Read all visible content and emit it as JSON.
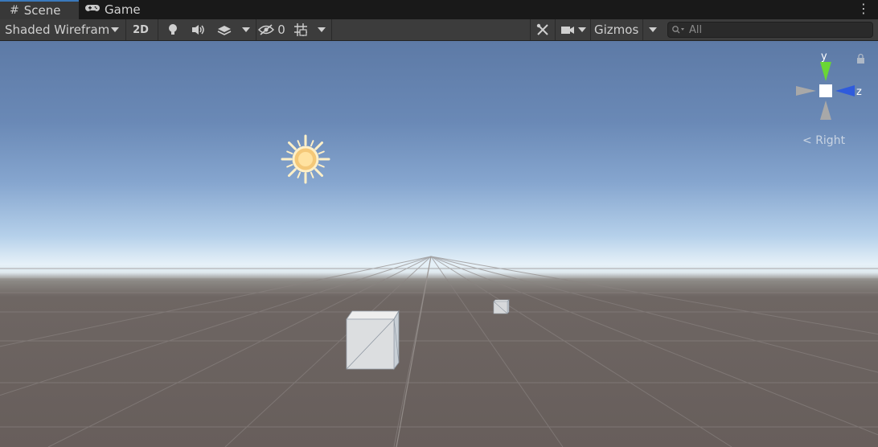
{
  "tabs": [
    {
      "label": "Scene",
      "icon": "grid-icon",
      "active": true
    },
    {
      "label": "Game",
      "icon": "gamepad-icon",
      "active": false
    }
  ],
  "toolbar": {
    "draw_mode": "Shaded Wireframe",
    "mode_2d": "2D",
    "hidden_count": "0",
    "gizmos": "Gizmos"
  },
  "search": {
    "placeholder": "All"
  },
  "orientation_gizmo": {
    "y": "y",
    "z": "z",
    "view_label": "Right",
    "colors": {
      "y": "#6ad635",
      "z": "#2f5bdc",
      "neutral": "#a8a8a8"
    }
  },
  "colors": {
    "accent": "#3a79bb",
    "sun": "#fff0c8"
  }
}
